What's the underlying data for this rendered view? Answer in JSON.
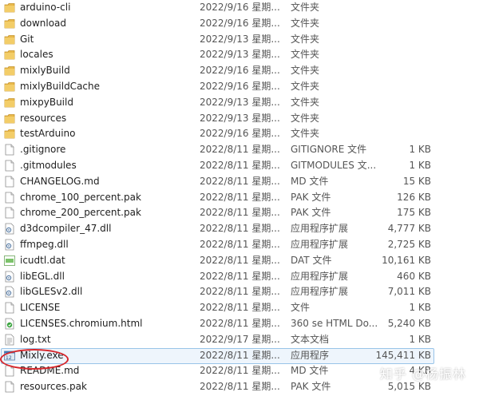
{
  "files": [
    {
      "name": "arduino-cli",
      "date": "2022/9/16 星期...",
      "type": "文件夹",
      "size": "",
      "icon": "folder-icon"
    },
    {
      "name": "download",
      "date": "2022/9/16 星期...",
      "type": "文件夹",
      "size": "",
      "icon": "folder-icon"
    },
    {
      "name": "Git",
      "date": "2022/9/13 星期...",
      "type": "文件夹",
      "size": "",
      "icon": "folder-icon"
    },
    {
      "name": "locales",
      "date": "2022/9/13 星期...",
      "type": "文件夹",
      "size": "",
      "icon": "folder-icon"
    },
    {
      "name": "mixlyBuild",
      "date": "2022/9/16 星期...",
      "type": "文件夹",
      "size": "",
      "icon": "folder-icon"
    },
    {
      "name": "mixlyBuildCache",
      "date": "2022/9/16 星期...",
      "type": "文件夹",
      "size": "",
      "icon": "folder-icon"
    },
    {
      "name": "mixpyBuild",
      "date": "2022/9/13 星期...",
      "type": "文件夹",
      "size": "",
      "icon": "folder-icon"
    },
    {
      "name": "resources",
      "date": "2022/9/13 星期...",
      "type": "文件夹",
      "size": "",
      "icon": "folder-icon"
    },
    {
      "name": "testArduino",
      "date": "2022/9/16 星期...",
      "type": "文件夹",
      "size": "",
      "icon": "folder-icon"
    },
    {
      "name": ".gitignore",
      "date": "2022/8/11 星期...",
      "type": "GITIGNORE 文件",
      "size": "1 KB",
      "icon": "file-icon"
    },
    {
      "name": ".gitmodules",
      "date": "2022/8/11 星期...",
      "type": "GITMODULES 文...",
      "size": "1 KB",
      "icon": "file-icon"
    },
    {
      "name": "CHANGELOG.md",
      "date": "2022/8/11 星期...",
      "type": "MD 文件",
      "size": "15 KB",
      "icon": "file-icon"
    },
    {
      "name": "chrome_100_percent.pak",
      "date": "2022/8/11 星期...",
      "type": "PAK 文件",
      "size": "126 KB",
      "icon": "file-icon"
    },
    {
      "name": "chrome_200_percent.pak",
      "date": "2022/8/11 星期...",
      "type": "PAK 文件",
      "size": "175 KB",
      "icon": "file-icon"
    },
    {
      "name": "d3dcompiler_47.dll",
      "date": "2022/8/11 星期...",
      "type": "应用程序扩展",
      "size": "4,777 KB",
      "icon": "dll-icon"
    },
    {
      "name": "ffmpeg.dll",
      "date": "2022/8/11 星期...",
      "type": "应用程序扩展",
      "size": "2,725 KB",
      "icon": "dll-icon"
    },
    {
      "name": "icudtl.dat",
      "date": "2022/8/11 星期...",
      "type": "DAT 文件",
      "size": "10,161 KB",
      "icon": "dat-icon"
    },
    {
      "name": "libEGL.dll",
      "date": "2022/8/11 星期...",
      "type": "应用程序扩展",
      "size": "460 KB",
      "icon": "dll-icon"
    },
    {
      "name": "libGLESv2.dll",
      "date": "2022/8/11 星期...",
      "type": "应用程序扩展",
      "size": "7,011 KB",
      "icon": "dll-icon"
    },
    {
      "name": "LICENSE",
      "date": "2022/8/11 星期...",
      "type": "文件",
      "size": "1 KB",
      "icon": "file-icon"
    },
    {
      "name": "LICENSES.chromium.html",
      "date": "2022/8/11 星期...",
      "type": "360 se HTML Do...",
      "size": "5,240 KB",
      "icon": "html-icon"
    },
    {
      "name": "log.txt",
      "date": "2022/9/17 星期...",
      "type": "文本文档",
      "size": "1 KB",
      "icon": "text-file-icon"
    },
    {
      "name": "Mixly.exe",
      "date": "2022/8/11 星期...",
      "type": "应用程序",
      "size": "145,411 KB",
      "icon": "exe-icon",
      "selected": true
    },
    {
      "name": "README.md",
      "date": "2022/8/11 星期...",
      "type": "MD 文件",
      "size": "4 KB",
      "icon": "file-icon"
    },
    {
      "name": "resources.pak",
      "date": "2022/8/11 星期...",
      "type": "PAK 文件",
      "size": "5,015 KB",
      "icon": "file-icon"
    }
  ],
  "watermark": "知乎 @杨振林",
  "colors": {
    "folder": "#e8b84a",
    "selection_border": "#99c4e8",
    "selection_fill": "#eef5fc",
    "annotation_red": "#d6262b"
  }
}
